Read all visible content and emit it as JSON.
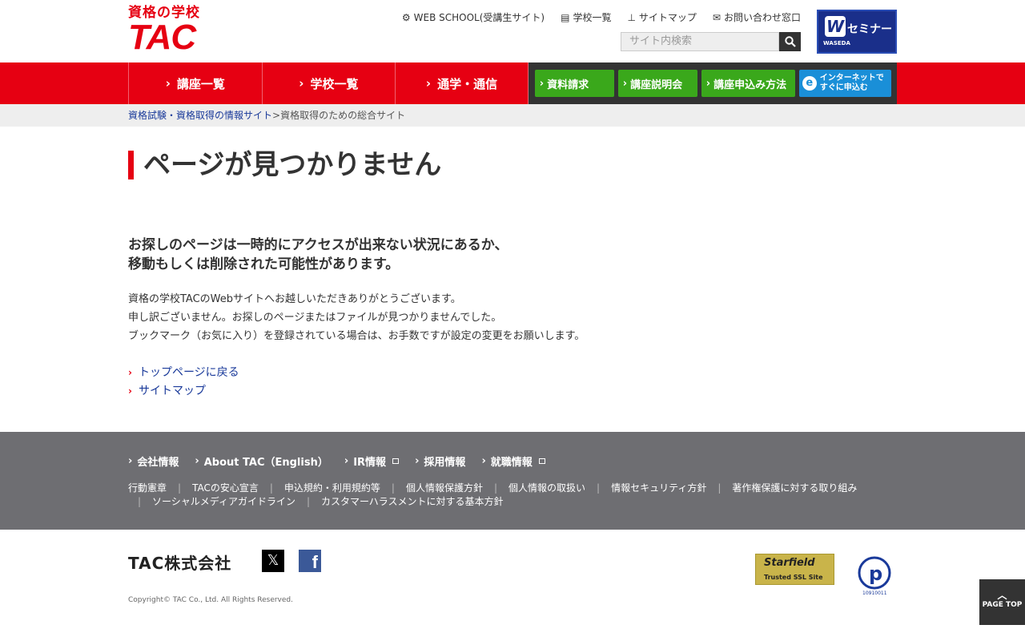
{
  "header": {
    "logo_sub": "資格の学校",
    "logo_main": "TAC",
    "util_links": [
      {
        "icon": "gear-icon",
        "label": "WEB SCHOOL(受講生サイト)"
      },
      {
        "icon": "building-icon",
        "label": "学校一覧"
      },
      {
        "icon": "sitemap-icon",
        "label": "サイトマップ"
      },
      {
        "icon": "mail-icon",
        "label": "お問い合わせ窓口"
      }
    ],
    "search_placeholder": "サイト内検索",
    "wseminar": {
      "mark": "W",
      "title": "セミナー",
      "sub": "WASEDA"
    }
  },
  "nav": {
    "items": [
      "講座一覧",
      "学校一覧",
      "通学・通信"
    ],
    "actions": [
      "資料請求",
      "講座説明会",
      "講座申込み方法"
    ],
    "internet_line1": "インターネットで",
    "internet_line2": "すぐに申込む"
  },
  "breadcrumb": {
    "link": "資格試験・資格取得の情報サイト",
    "sep": ">",
    "current": "資格取得のための総合サイト"
  },
  "main": {
    "title": "ページが見つかりません",
    "lead_line1": "お探しのページは一時的にアクセスが出来ない状況にあるか、",
    "lead_line2": "移動もしくは削除された可能性があります。",
    "body_line1": "資格の学校TACのWebサイトへお越しいただきありがとうございます。",
    "body_line2": "申し訳ございません。お探しのページまたはファイルが見つかりませんでした。",
    "body_line3": "ブックマーク（お気に入り）を登録されている場合は、お手数ですが設定の変更をお願いします。",
    "links": [
      "トップページに戻る",
      "サイトマップ"
    ]
  },
  "footer": {
    "main_links": [
      "会社情報",
      "About TAC（English）",
      "IR情報",
      "採用情報",
      "就職情報"
    ],
    "sub_links": [
      "行動憲章",
      "TACの安心宣言",
      "申込規約・利用規約等",
      "個人情報保護方針",
      "個人情報の取扱い",
      "情報セキュリティ方針",
      "著作権保護に対する取り組み",
      "ソーシャルメディアガイドライン",
      "カスタマーハラスメントに対する基本方針"
    ],
    "brand": "TAC株式会社",
    "copyright": "Copyright© TAC Co., Ltd. All Rights Reserved.",
    "ssl_line1": "Starfield",
    "ssl_line2": "Trusted SSL Site",
    "privacy_code": "10910011",
    "page_top": "PAGE TOP"
  }
}
